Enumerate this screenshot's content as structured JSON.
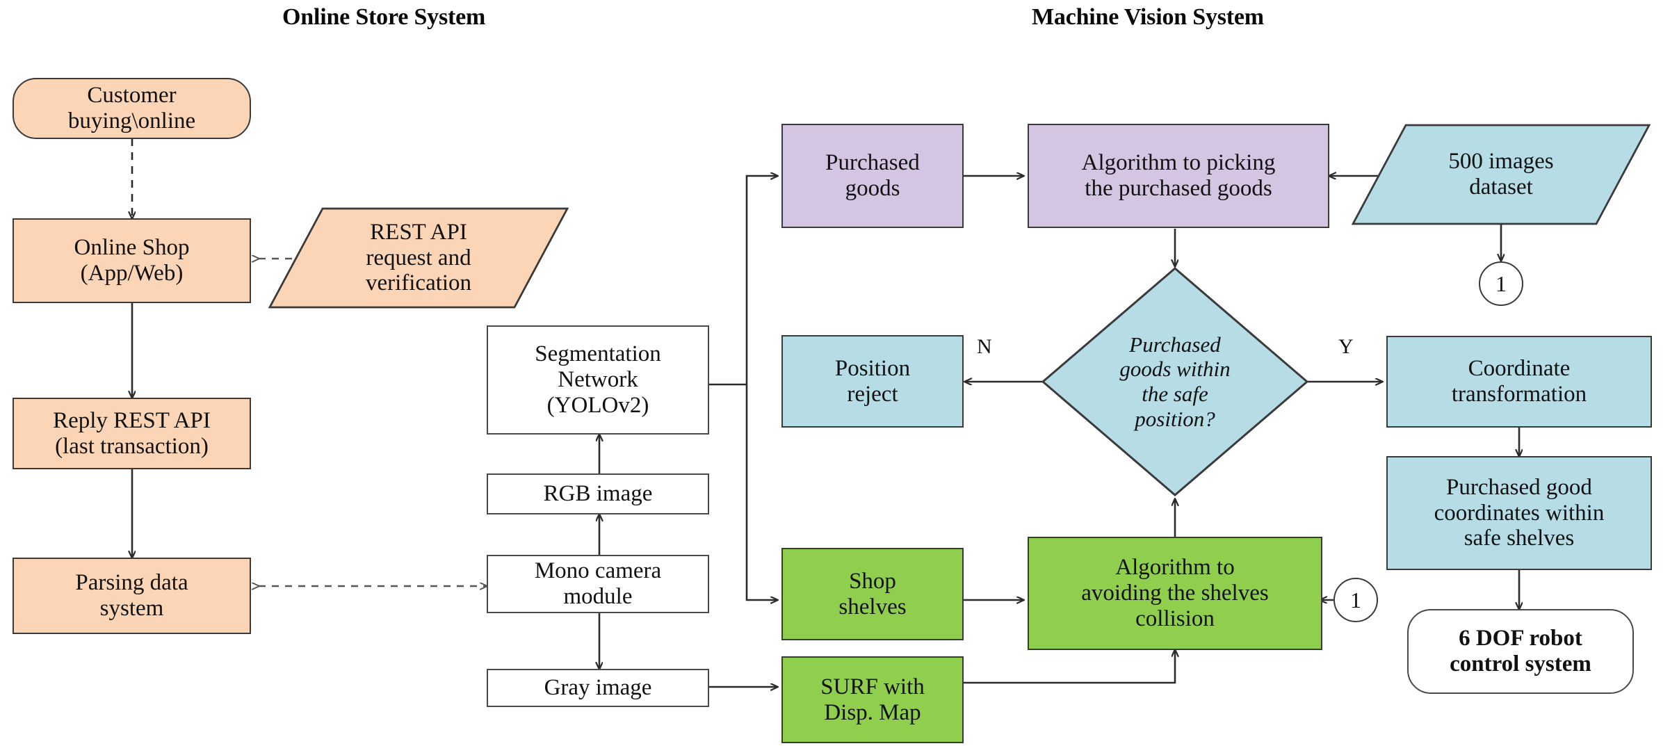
{
  "titles": {
    "left": "Online Store System",
    "right": "Machine Vision System"
  },
  "colors": {
    "orange": "#fbd5b5",
    "purple": "#d4c5e2",
    "blue": "#b6dce6",
    "green": "#90ce4e",
    "white": "#ffffff",
    "stroke": "#3a3a3a"
  },
  "online_store": {
    "customer": "Customer\nbuying\\online",
    "customer_line1": "Customer",
    "customer_line2": "buying\\online",
    "online_shop_line1": "Online Shop",
    "online_shop_line2": "(App/Web)",
    "rest_api_line1": "REST API",
    "rest_api_line2": "request and",
    "rest_api_line3": "verification",
    "reply_line1": "Reply REST API",
    "reply_line2": "(last transaction)",
    "parsing_line1": "Parsing data",
    "parsing_line2": "system"
  },
  "camera_chain": {
    "segmentation_line1": "Segmentation",
    "segmentation_line2": "Network",
    "segmentation_line3": "(YOLOv2)",
    "rgb_image": "RGB image",
    "mono_line1": "Mono camera",
    "mono_line2": "module",
    "gray_image": "Gray image"
  },
  "machine_vision": {
    "purchased_goods_line1": "Purchased",
    "purchased_goods_line2": "goods",
    "algo_pick_line1": "Algorithm to picking",
    "algo_pick_line2": "the purchased goods",
    "dataset_line1": "500 images",
    "dataset_line2": "dataset",
    "position_reject_line1": "Position",
    "position_reject_line2": "reject",
    "decision_line1": "Purchased",
    "decision_line2": "goods within",
    "decision_line3": "the safe",
    "decision_line4": "position?",
    "coord_transform_line1": "Coordinate",
    "coord_transform_line2": "transformation",
    "safe_coords_line1": "Purchased good",
    "safe_coords_line2": "coordinates within",
    "safe_coords_line3": "safe shelves",
    "robot_line1": "6 DOF robot",
    "robot_line2": "control system",
    "shop_shelves_line1": "Shop",
    "shop_shelves_line2": "shelves",
    "algo_avoid_line1": "Algorithm to",
    "algo_avoid_line2": "avoiding the shelves",
    "algo_avoid_line3": "collision",
    "surf_line1": "SURF with",
    "surf_line2": "Disp. Map"
  },
  "edge_labels": {
    "no": "N",
    "yes": "Y"
  },
  "connectors": {
    "ref_dataset": "1",
    "ref_collision": "1"
  }
}
